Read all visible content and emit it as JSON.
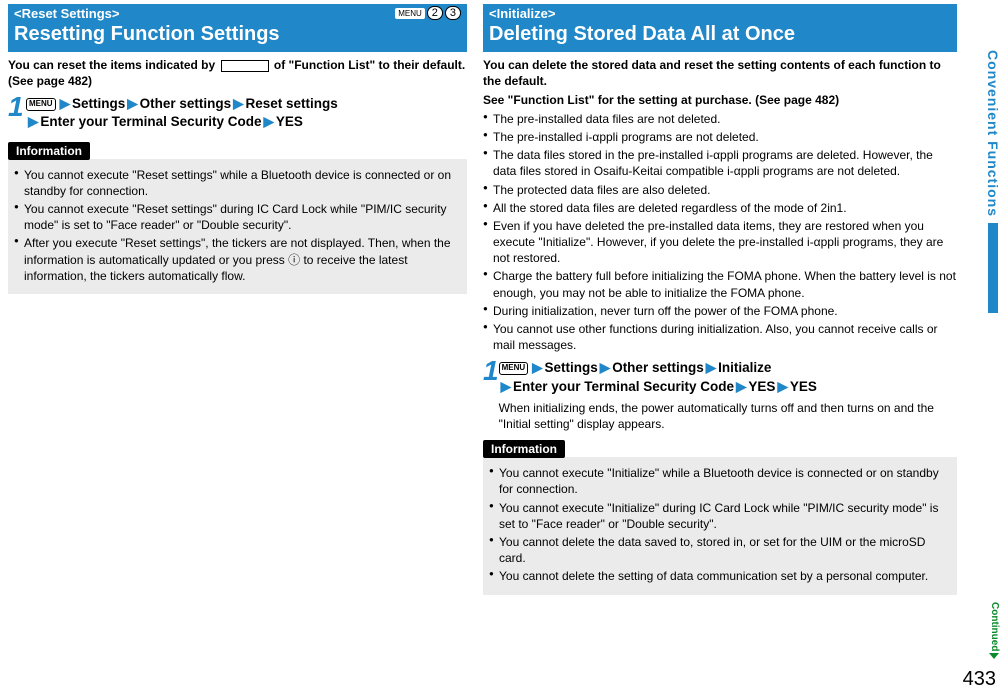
{
  "left": {
    "tag": "<Reset Settings>",
    "title": "Resetting Function Settings",
    "menu_icon_label": "MENU",
    "icon_num1": "2",
    "icon_num2": "3",
    "lead1": "You can reset the items indicated by ",
    "lead2": " of \"Function List\" to their default. (See page 482)",
    "step_num": "1",
    "step_menu": "MENU",
    "step_s1": "Settings",
    "step_s2": "Other settings",
    "step_s3": "Reset settings",
    "step_s4": "Enter your Terminal Security Code",
    "step_s5": "YES",
    "info_label": "Information",
    "info": [
      "You cannot execute \"Reset settings\" while a Bluetooth device is connected or on standby for connection.",
      "You cannot execute \"Reset settings\" during IC Card Lock while \"PIM/IC security mode\" is set to \"Face reader\" or \"Double security\".",
      "After you execute \"Reset settings\", the tickers are not displayed. Then, when the information is automatically updated or you press ⓘ to receive the latest information, the tickers automatically flow."
    ]
  },
  "right": {
    "tag": "<Initialize>",
    "title": "Deleting Stored Data All at Once",
    "lead1": "You can delete the stored data and reset the setting contents of each function to the default.",
    "lead2": "See \"Function List\" for the setting at purchase. (See page 482)",
    "bullets": [
      "The pre-installed data files are not deleted.",
      "The pre-installed i-αppli programs are not deleted.",
      "The data files stored in the pre-installed i-αppli programs are deleted. However, the data files stored in Osaifu-Keitai compatible i-αppli programs are not deleted.",
      "The protected data files are also deleted.",
      "All the stored data files are deleted regardless of the mode of 2in1.",
      "Even if you have deleted the pre-installed data items, they are restored when you execute \"Initialize\". However, if you delete the pre-installed i-αppli programs, they are not restored.",
      "Charge the battery full before initializing the FOMA phone. When the battery level is not enough, you may not be able to initialize the FOMA phone.",
      "During initialization, never turn off the power of the FOMA phone.",
      "You cannot use other functions during initialization. Also, you cannot receive calls or mail messages."
    ],
    "step_num": "1",
    "step_menu": "MENU",
    "step_s1": "Settings",
    "step_s2": "Other settings",
    "step_s3": "Initialize",
    "step_s4": "Enter your Terminal Security Code",
    "step_s5": "YES",
    "step_s6": "YES",
    "step_sub": "When initializing ends, the power automatically turns off and then turns on and the \"Initial setting\" display appears.",
    "info_label": "Information",
    "info": [
      "You cannot execute \"Initialize\" while a Bluetooth device is connected or on standby for connection.",
      "You cannot execute \"Initialize\" during IC Card Lock while \"PIM/IC security mode\" is set to \"Face reader\" or \"Double security\".",
      "You cannot delete the data saved to, stored in, or set for the UIM or the microSD card.",
      "You cannot delete the setting of data communication set by a personal computer."
    ]
  },
  "side": {
    "label": "Convenient Functions",
    "continued": "Continued",
    "page": "433"
  }
}
